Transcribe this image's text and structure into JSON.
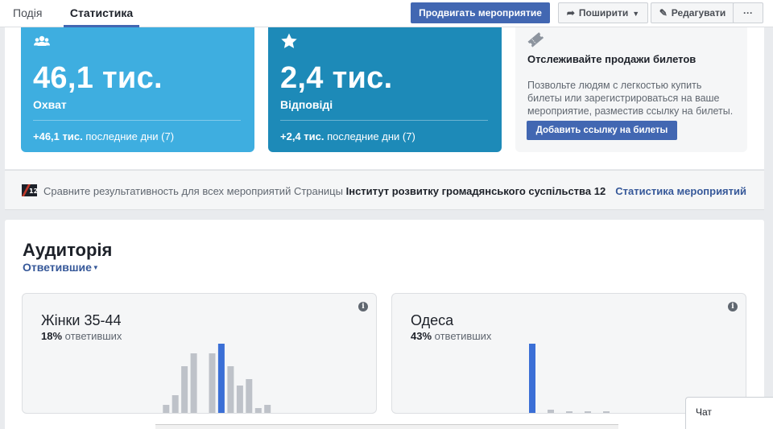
{
  "tabs": {
    "event": "Подія",
    "stats": "Статистика"
  },
  "actions": {
    "promote": "Продвигать мероприятие",
    "share": "Поширити",
    "edit": "Редагувати",
    "more": "···"
  },
  "stats": {
    "reach": {
      "value": "46,1 тис.",
      "label": "Охват",
      "delta": "+46,1 тис.",
      "period": "последние дни (7)"
    },
    "responses": {
      "value": "2,4 тис.",
      "label": "Відповіді",
      "delta": "+2,4 тис.",
      "period": "последние дни (7)"
    }
  },
  "tickets": {
    "title": "Отслеживайте продажи билетов",
    "description": "Позвольте людям с легкостью купить билеты или зарегистрироваться на ваше мероприятие, разместив ссылку на билеты.",
    "button": "Добавить ссылку на билеты"
  },
  "compare": {
    "text": "Сравните результативность для всех мероприятий Страницы",
    "page": "Інститут розвитку громадянського суспільства 12",
    "link": "Статистика мероприятий"
  },
  "audience": {
    "title": "Аудиторія",
    "filter": "Ответившие",
    "gender_card": {
      "title": "Жінки 35-44",
      "percent": "18%",
      "suffix": "ответивших"
    },
    "city_card": {
      "title": "Одеса",
      "percent": "43%",
      "suffix": "ответивших"
    }
  },
  "chart_data": [
    {
      "type": "bar",
      "series": [
        {
          "values": [
            0,
            0,
            0.5,
            0.5,
            0,
            3,
            6,
            15,
            19,
            0,
            19,
            22,
            15,
            9,
            11,
            2,
            3
          ]
        }
      ],
      "highlight_index": 11,
      "ylim": [
        0,
        24
      ]
    },
    {
      "type": "bar",
      "series": [
        {
          "values": [
            22,
            0,
            1.5,
            0,
            1,
            0,
            1,
            0,
            1
          ]
        }
      ],
      "highlight_index": 0,
      "ylim": [
        0,
        24
      ]
    }
  ],
  "chat": {
    "label": "Чат"
  },
  "colors": {
    "accent": "#4267b2",
    "reach": "#3eaee0",
    "responses": "#1d8ab8",
    "bar": "#bec2c9",
    "bar_highlight": "#3b6fd6"
  }
}
